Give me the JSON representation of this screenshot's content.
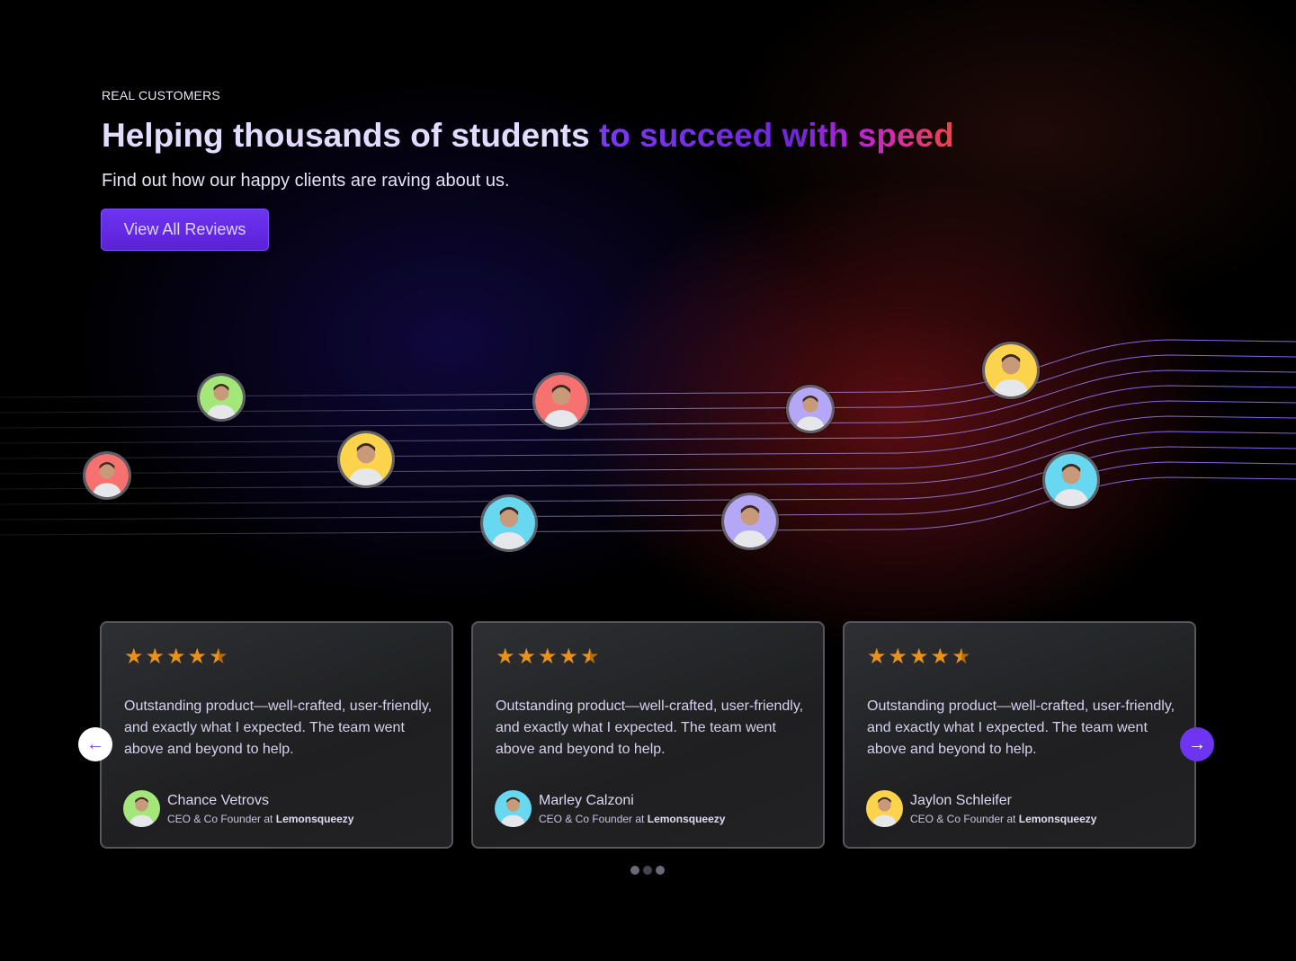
{
  "hero": {
    "eyebrow": "REAL CUSTOMERS",
    "title_plain": "Helping thousands of students ",
    "title_highlight": "to succeed with speed",
    "subtitle": "Find out how our happy clients are raving about us.",
    "cta_label": "View All Reviews"
  },
  "colors": {
    "accent": "#6d35f2",
    "star": "#e8921a",
    "highlight_start": "#7c3aed",
    "highlight_end": "#ef4444"
  },
  "avatars": [
    {
      "bg": "#f87171"
    },
    {
      "bg": "#a3e67a"
    },
    {
      "bg": "#fcd34d"
    },
    {
      "bg": "#f87171"
    },
    {
      "bg": "#67d8f0"
    },
    {
      "bg": "#b4a7f5"
    },
    {
      "bg": "#b4a7f5"
    },
    {
      "bg": "#fcd34d"
    },
    {
      "bg": "#67d8f0"
    }
  ],
  "reviews": [
    {
      "rating": 4.5,
      "text": "Outstanding product—well-crafted, user-friendly, and exactly what I expected. The team went above and beyond to help.",
      "name": "Chance Vetrovs",
      "role": "CEO & Co Founder at ",
      "company": "Lemonsqueezy",
      "avatar_bg": "#a3e67a"
    },
    {
      "rating": 4.5,
      "text": "Outstanding product—well-crafted, user-friendly, and exactly what I expected. The team went above and beyond to help.",
      "name": "Marley Calzoni",
      "role": "CEO & Co Founder at ",
      "company": "Lemonsqueezy",
      "avatar_bg": "#67d8f0"
    },
    {
      "rating": 4.5,
      "text": "Outstanding product—well-crafted, user-friendly, and exactly what I expected. The team went above and beyond to help.",
      "name": "Jaylon Schleifer",
      "role": "CEO & Co Founder at ",
      "company": "Lemonsqueezy",
      "avatar_bg": "#fcd34d"
    }
  ],
  "carousel": {
    "prev_icon": "arrow-left-icon",
    "next_icon": "arrow-right-icon",
    "pages": 3,
    "active_page": 2
  }
}
